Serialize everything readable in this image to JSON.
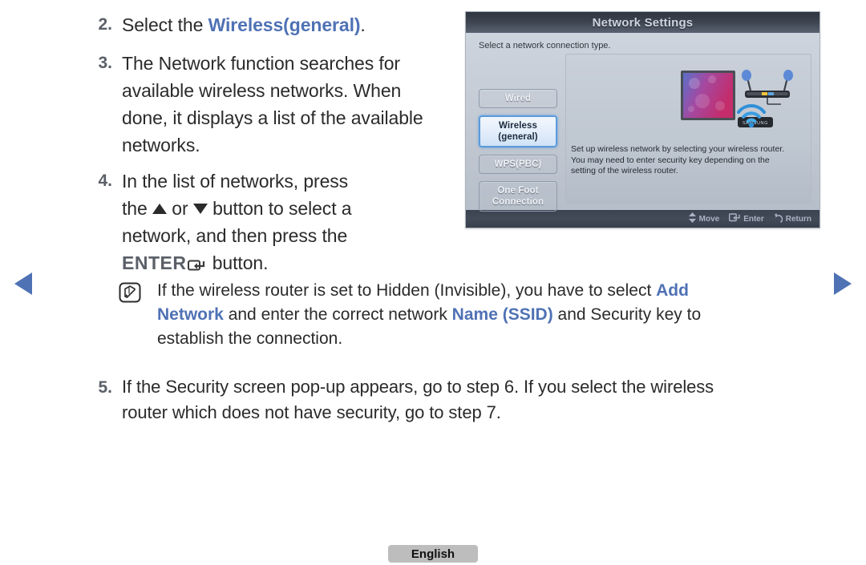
{
  "nav": {
    "prev_icon": "triangle-left-icon",
    "next_icon": "triangle-right-icon",
    "accent_color": "#4f72b5"
  },
  "steps": [
    {
      "number": "2.",
      "segments": [
        {
          "text": "Select the ",
          "style": "normal"
        },
        {
          "text": "Wireless(general)",
          "style": "highlight"
        },
        {
          "text": ".",
          "style": "normal"
        }
      ],
      "plain": "Select the Wireless(general)."
    },
    {
      "number": "3.",
      "plain": "The Network function searches for available wireless networks. When done, it displays a list of the available networks."
    },
    {
      "number": "4.",
      "plain": "In the list of networks, press the ▲ or ▼ button to select a network, and then press the ENTER↵ button.",
      "parts": {
        "a": "In the list of networks, press",
        "b_pre": "the ",
        "b_mid": " or ",
        "b_post": " button to select a",
        "c": "network, and then press the",
        "d_enter": "ENTER",
        "d_post": " button."
      }
    },
    {
      "number": "5.",
      "plain": "If the Security screen pop-up appears, go to step 6. If you select the wireless router which does not have security, go to step 7.",
      "line1": "If the Security screen pop-up appears, go to step 6. If you select the wireless",
      "line2": "router which does not have security, go to step 7."
    }
  ],
  "note": {
    "icon": "note-pencil-icon",
    "line1_a": "If the wireless router is set to Hidden (Invisible), you have to select ",
    "line1_hl": "Add",
    "line2_hl_a": "Network",
    "line2_b": " and enter the correct network ",
    "line2_hl_b": "Name (SSID)",
    "line2_c": " and Security key to",
    "line3": "establish the connection.",
    "plain": "If the wireless router is set to Hidden (Invisible), you have to select Add Network and enter the correct network Name (SSID) and Security key to establish the connection."
  },
  "tv": {
    "title": "Network Settings",
    "subtitle": "Select a network connection type.",
    "menu": [
      {
        "label": "Wired",
        "selected": false
      },
      {
        "label_line1": "Wireless",
        "label_line2": "(general)",
        "selected": true
      },
      {
        "label": "WPS(PBC)",
        "selected": false
      },
      {
        "label_line1": "One Foot",
        "label_line2": "Connection",
        "selected": false
      }
    ],
    "description_line1": "Set up wireless network by selecting your wireless router.",
    "description_line2": "You may need to enter security key depending on the",
    "description_line3": "setting of the wireless router.",
    "illustration": {
      "tv_brand": "SAMSUNG",
      "elements": [
        "tv-icon",
        "router-icon",
        "wifi-signal-icon"
      ]
    },
    "footer": [
      {
        "icon": "up-down-arrow-icon",
        "label": "Move"
      },
      {
        "icon": "enter-key-icon",
        "label": "Enter"
      },
      {
        "icon": "return-arrow-icon",
        "label": "Return"
      }
    ]
  },
  "footer": {
    "language": "English"
  }
}
